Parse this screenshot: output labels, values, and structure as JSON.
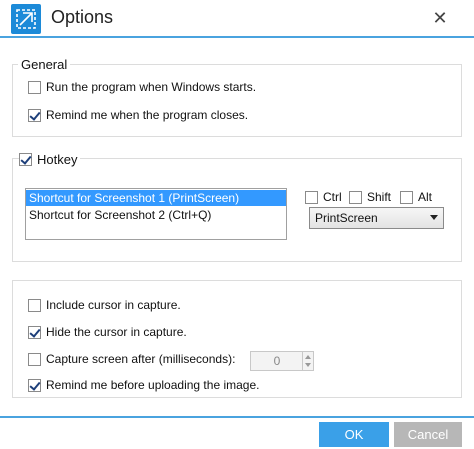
{
  "window": {
    "title": "Options",
    "close_symbol": "✕",
    "accent": "#1c8ad8",
    "border_accent": "#4aa3df"
  },
  "general": {
    "legend": "General",
    "options": [
      {
        "label": "Run the program when Windows starts.",
        "checked": false
      },
      {
        "label": "Remind me when the program closes.",
        "checked": true
      }
    ]
  },
  "hotkey": {
    "legend": "Hotkey",
    "enabled": true,
    "shortcuts": [
      {
        "label": "Shortcut for Screenshot 1 (PrintScreen)",
        "selected": true
      },
      {
        "label": "Shortcut for Screenshot 2 (Ctrl+Q)",
        "selected": false
      }
    ],
    "modifiers": [
      {
        "label": "Ctrl",
        "checked": false
      },
      {
        "label": "Shift",
        "checked": false
      },
      {
        "label": "Alt",
        "checked": false
      }
    ],
    "key_selected": "PrintScreen"
  },
  "capture": {
    "options": [
      {
        "label": "Include cursor in capture.",
        "checked": false
      },
      {
        "label": "Hide the cursor in capture.",
        "checked": true
      },
      {
        "label": "Capture screen after (milliseconds):",
        "checked": false
      },
      {
        "label": "Remind me before uploading the image.",
        "checked": true
      }
    ],
    "delay_value": "0"
  },
  "footer": {
    "ok_label": "OK",
    "cancel_label": "Cancel",
    "ok_color": "#3aa0e8",
    "cancel_color": "#b7b7b7"
  }
}
